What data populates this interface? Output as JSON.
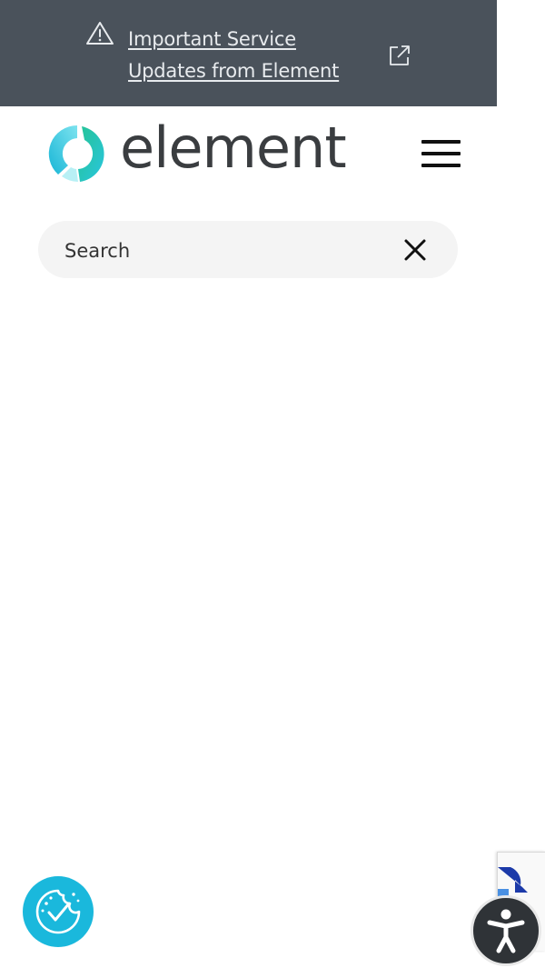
{
  "banner": {
    "link_line1": "Important Service",
    "link_line2": "Updates from Element",
    "warning_icon": "warning-icon",
    "external_icon": "external-link-icon",
    "background": "#4a525b"
  },
  "header": {
    "logo_text": "element",
    "logo_icon": "element-logo-icon",
    "menu_icon": "hamburger-menu-icon"
  },
  "search": {
    "placeholder": "Search",
    "value": "",
    "clear_icon": "close-icon"
  },
  "widgets": {
    "cookie_icon": "cookie-consent-icon",
    "accessibility_icon": "accessibility-icon",
    "recaptcha_icon": "recaptcha-icon"
  },
  "colors": {
    "accent": "#1ab8dc",
    "text_dark": "#3a3d40"
  }
}
